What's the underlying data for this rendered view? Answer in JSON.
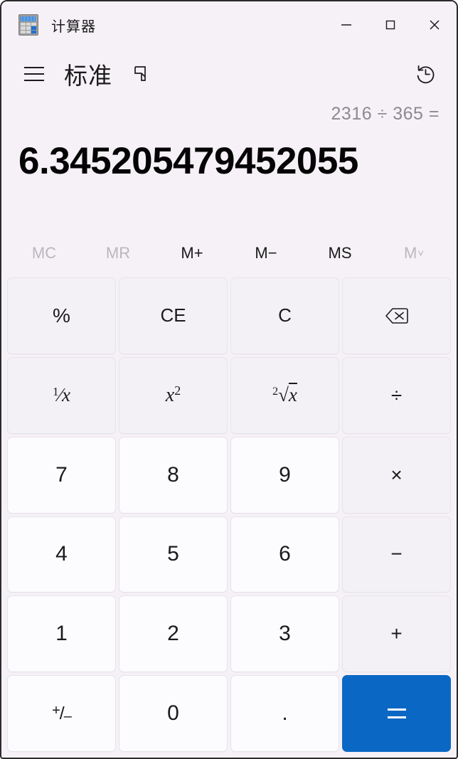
{
  "window": {
    "title": "计算器",
    "app_icon": "calculator-icon",
    "controls": {
      "minimize": "minimize-icon",
      "maximize": "maximize-icon",
      "close": "close-icon"
    }
  },
  "header": {
    "menu_icon": "hamburger-menu-icon",
    "mode_title": "标准",
    "keep_on_top_icon": "keep-on-top-icon",
    "history_icon": "history-icon"
  },
  "display": {
    "expression": "2316 ÷ 365 =",
    "result": "6.345205479452055"
  },
  "memory": {
    "buttons": [
      {
        "label": "MC",
        "name": "memory-clear-button",
        "disabled": true
      },
      {
        "label": "MR",
        "name": "memory-recall-button",
        "disabled": true
      },
      {
        "label": "M+",
        "name": "memory-add-button",
        "disabled": false
      },
      {
        "label": "M−",
        "name": "memory-subtract-button",
        "disabled": false
      },
      {
        "label": "MS",
        "name": "memory-store-button",
        "disabled": false
      },
      {
        "label": "M",
        "name": "memory-dropdown-button",
        "disabled": true,
        "chevron": "˅"
      }
    ]
  },
  "keypad": {
    "percent": "%",
    "clear_entry": "CE",
    "clear": "C",
    "backspace": "backspace-icon",
    "reciprocal": {
      "numerator": "1",
      "base": "x"
    },
    "square": {
      "base": "x",
      "exponent": "2"
    },
    "sqrt": {
      "index": "2",
      "base": "x"
    },
    "divide": "÷",
    "seven": "7",
    "eight": "8",
    "nine": "9",
    "multiply": "×",
    "four": "4",
    "five": "5",
    "six": "6",
    "subtract": "−",
    "one": "1",
    "two": "2",
    "three": "3",
    "add": "+",
    "negate": {
      "plus": "+",
      "slash": "/",
      "minus": "–"
    },
    "zero": "0",
    "decimal": ".",
    "equals": "="
  },
  "colors": {
    "accent": "#0a68c4",
    "background": "#f6f1f7",
    "number_key": "#fcfbfd",
    "operator_key": "#f4f1f6",
    "text": "#1b1b1b",
    "muted_text": "#8c8a91",
    "disabled_text": "#b9b7bd"
  }
}
